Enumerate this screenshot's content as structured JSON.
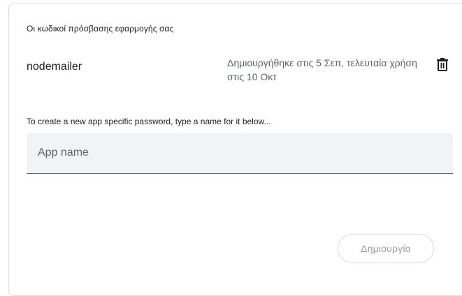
{
  "section": {
    "title": "Οι κωδικοί πρόσβασης εφαρμογής σας"
  },
  "passwords": [
    {
      "name": "nodemailer",
      "meta": "Δημιουργήθηκε στις 5 Σεπ, τελευταία χρήση στις 10 Οκτ",
      "delete_icon": "trash-icon"
    }
  ],
  "create": {
    "hint": "To create a new app specific password, type a name for it below...",
    "input_value": "",
    "input_placeholder": "App name",
    "button_label": "Δημιουργία",
    "button_enabled": false
  },
  "colors": {
    "text_primary": "#202124",
    "text_secondary": "#5f6368",
    "field_background": "#f1f3f4",
    "border": "#dadce0",
    "disabled_text": "#9aa0a6"
  }
}
